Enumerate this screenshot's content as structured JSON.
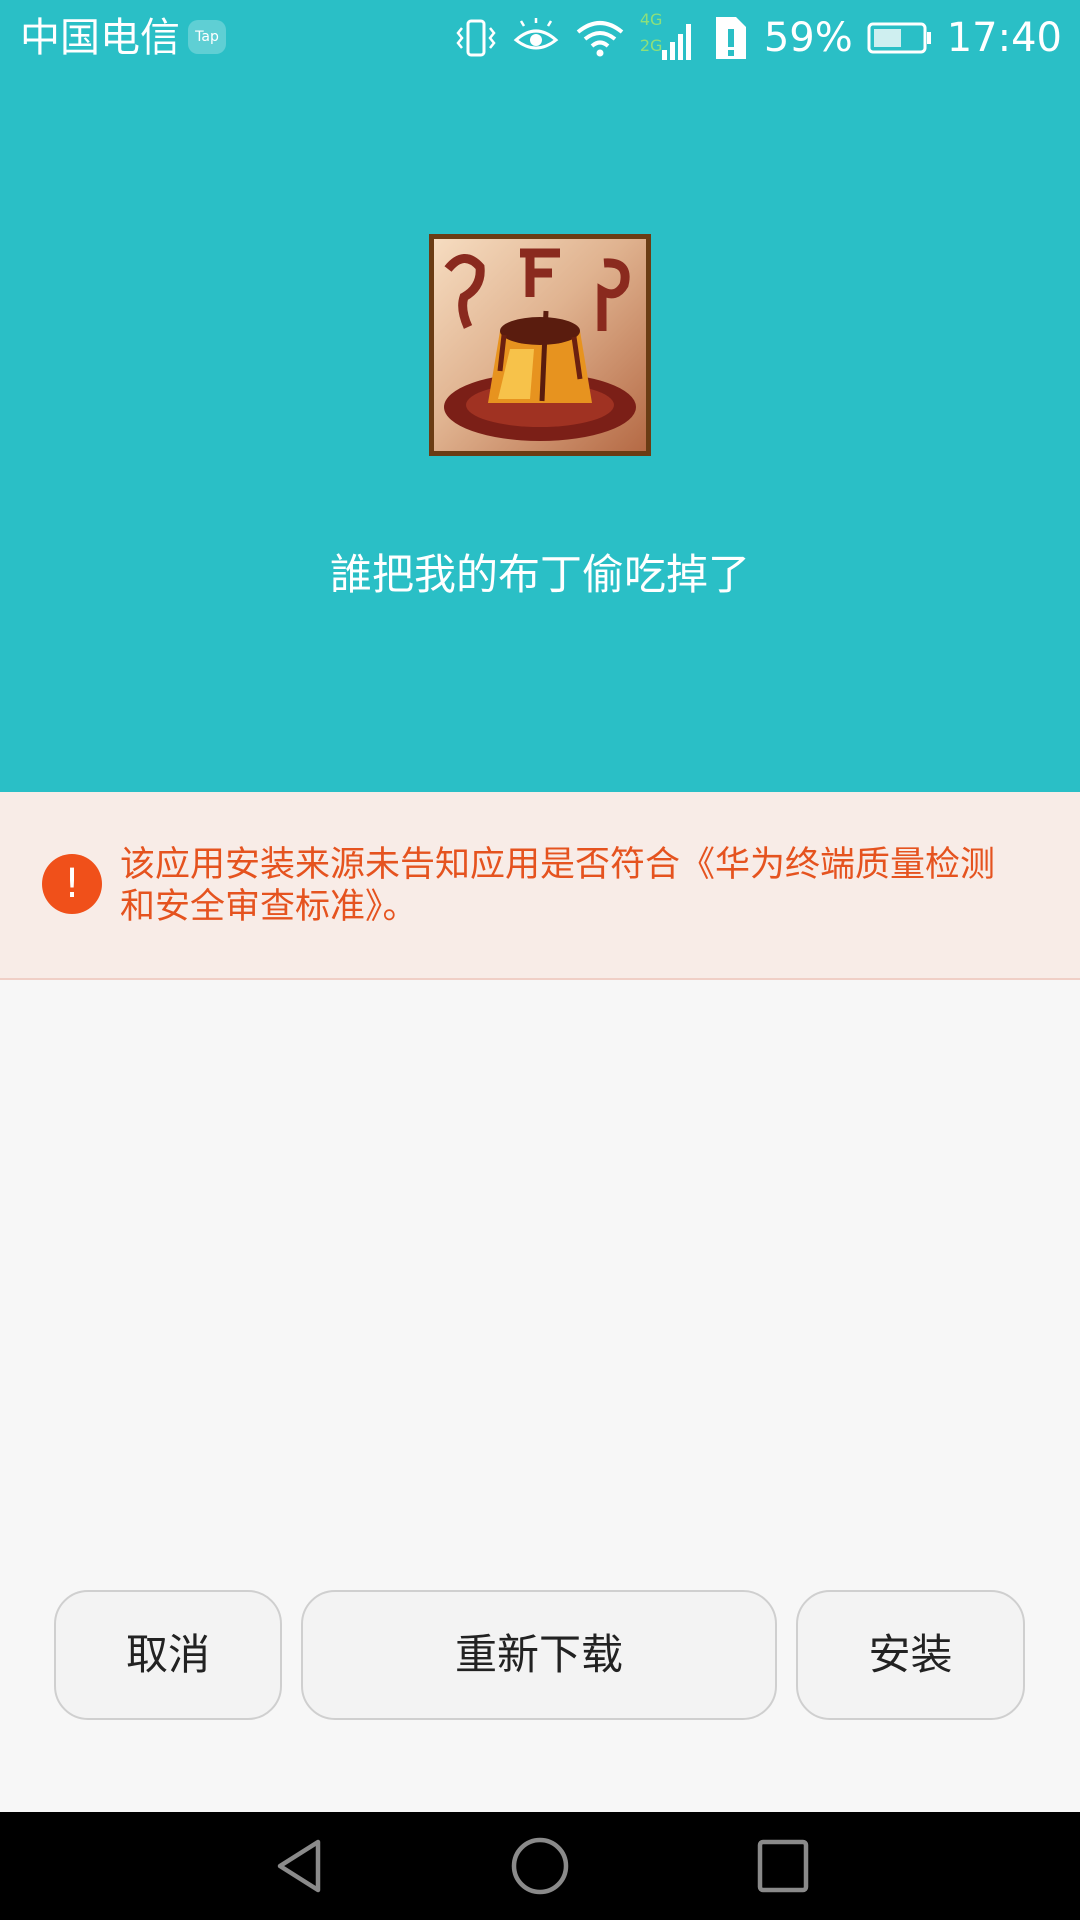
{
  "status_bar": {
    "carrier": "中国电信",
    "notification_badge": "Tap",
    "network_labels": [
      "4G",
      "2G"
    ],
    "battery_percent": "59%",
    "battery_level": 0.59,
    "time": "17:40",
    "icons": [
      "vibrate-icon",
      "eye-comfort-icon",
      "wifi-icon",
      "cellular-signal-icon",
      "sim-alert-icon",
      "battery-icon"
    ]
  },
  "app": {
    "name": "誰把我的布丁偷吃掉了",
    "icon": "pudding-app-icon"
  },
  "warning": {
    "icon": "exclamation-icon",
    "text": "该应用安装来源未告知应用是否符合《华为终端质量检测和安全审查标准》。"
  },
  "buttons": {
    "cancel": "取消",
    "redownload": "重新下载",
    "install": "安装"
  },
  "nav": {
    "icons": [
      "back-icon",
      "home-icon",
      "recents-icon"
    ]
  },
  "colors": {
    "header_bg": "#2abfc6",
    "warning_bg": "#f8ece7",
    "warning_text": "#e5531f",
    "warning_icon": "#f0501a",
    "body_bg": "#f7f7f7"
  }
}
